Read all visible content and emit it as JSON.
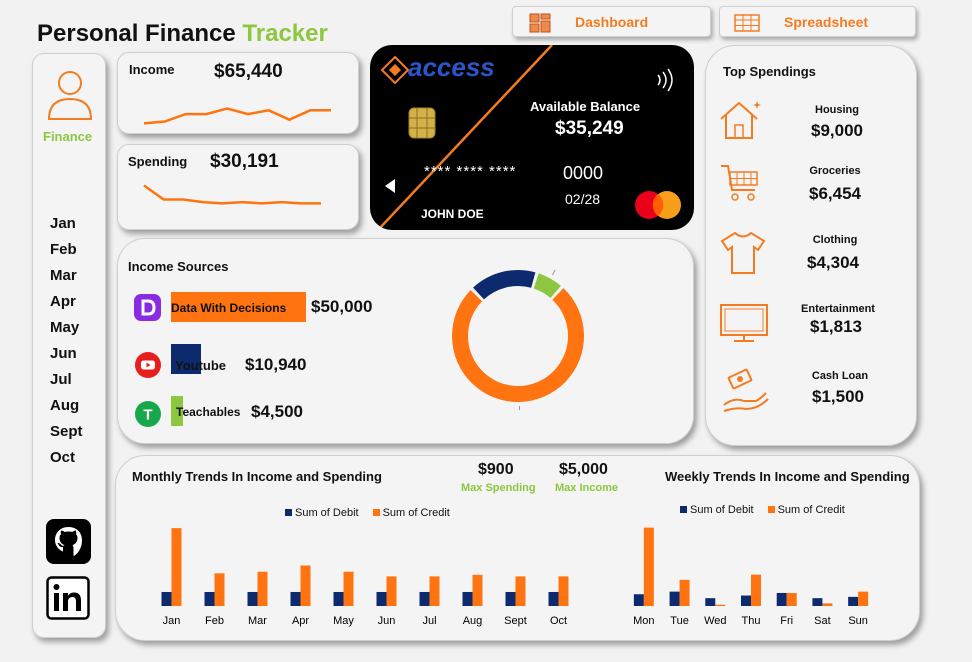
{
  "header": {
    "title_main": "Personal Finance",
    "title_accent": "Tracker"
  },
  "nav": {
    "dashboard_label": "Dashboard",
    "spreadsheet_label": "Spreadsheet"
  },
  "sidebar": {
    "profile_label": "Finance",
    "months": [
      "Jan",
      "Feb",
      "Mar",
      "Apr",
      "May",
      "Jun",
      "Jul",
      "Aug",
      "Sept",
      "Oct"
    ]
  },
  "income": {
    "label": "Income",
    "value": "$65,440"
  },
  "spending": {
    "label": "Spending",
    "value": "$30,191"
  },
  "bank_card": {
    "brand": "access",
    "balance_label": "Available Balance",
    "balance": "$35,249",
    "number": "**** **** ****",
    "last4": "0000",
    "expiry": "02/28",
    "holder": "JOHN DOE"
  },
  "income_sources": {
    "title": "Income Sources",
    "items": [
      {
        "name": "Data With Decisions",
        "value": "$50,000",
        "amount": 50000,
        "color": "#ff7410"
      },
      {
        "name": "Youtube",
        "value": "$10,940",
        "amount": 10940,
        "color": "#0e2a6e"
      },
      {
        "name": "Teachables",
        "value": "$4,500",
        "amount": 4500,
        "color": "#8dc63f"
      }
    ],
    "donut": [
      {
        "label": "76%",
        "value": 76,
        "color": "#ff7410"
      },
      {
        "label": "17%",
        "value": 17,
        "color": "#0e2a6e"
      },
      {
        "label": "7%",
        "value": 7,
        "color": "#8dc63f"
      }
    ]
  },
  "top_spendings": {
    "title": "Top Spendings",
    "items": [
      {
        "category": "Housing",
        "value": "$9,000",
        "icon": "house-icon"
      },
      {
        "category": "Groceries",
        "value": "$6,454",
        "icon": "cart-icon"
      },
      {
        "category": "Clothing",
        "value": "$4,304",
        "icon": "shirt-icon"
      },
      {
        "category": "Entertainment",
        "value": "$1,813",
        "icon": "monitor-icon"
      },
      {
        "category": "Cash Loan",
        "value": "$1,500",
        "icon": "cash-hand-icon"
      }
    ]
  },
  "trends": {
    "monthly_title": "Monthly Trends In Income and Spending",
    "weekly_title": "Weekly Trends In Income and Spending",
    "max_spending_value": "$900",
    "max_spending_label": "Max Spending",
    "max_income_value": "$5,000",
    "max_income_label": "Max Income"
  },
  "colors": {
    "orange": "#ff7410",
    "navy": "#0e2a6e",
    "green": "#8dc63f"
  },
  "chart_data": [
    {
      "type": "line",
      "title": "Income",
      "values": [
        3,
        4,
        8,
        8,
        11,
        8,
        10,
        5,
        10,
        10
      ],
      "color": "#ff7410"
    },
    {
      "type": "line",
      "title": "Spending",
      "values": [
        20,
        9,
        9,
        7,
        6,
        7,
        6,
        7,
        6,
        6
      ],
      "color": "#ff7410"
    },
    {
      "type": "bar",
      "title": "Monthly Trends In Income and Spending",
      "categories": [
        "Jan",
        "Feb",
        "Mar",
        "Apr",
        "May",
        "Jun",
        "Jul",
        "Aug",
        "Sept",
        "Oct"
      ],
      "series": [
        {
          "name": "Sum of Debit",
          "color": "#0e2a6e",
          "values": [
            900,
            900,
            900,
            900,
            900,
            900,
            900,
            900,
            900,
            900
          ]
        },
        {
          "name": "Sum of Credit",
          "color": "#ff7410",
          "values": [
            5000,
            2100,
            2200,
            2600,
            2200,
            1900,
            1900,
            2000,
            1900,
            1900
          ]
        }
      ],
      "ylim": [
        0,
        5200
      ]
    },
    {
      "type": "bar",
      "title": "Weekly Trends In Income and Spending",
      "categories": [
        "Mon",
        "Tue",
        "Wed",
        "Thu",
        "Fri",
        "Sat",
        "Sun"
      ],
      "series": [
        {
          "name": "Sum of Debit",
          "color": "#0e2a6e",
          "values": [
            900,
            1100,
            600,
            800,
            1000,
            600,
            700
          ]
        },
        {
          "name": "Sum of Credit",
          "color": "#ff7410",
          "values": [
            6000,
            2000,
            100,
            2400,
            1000,
            200,
            1100
          ]
        }
      ],
      "ylim": [
        0,
        6200
      ]
    }
  ]
}
